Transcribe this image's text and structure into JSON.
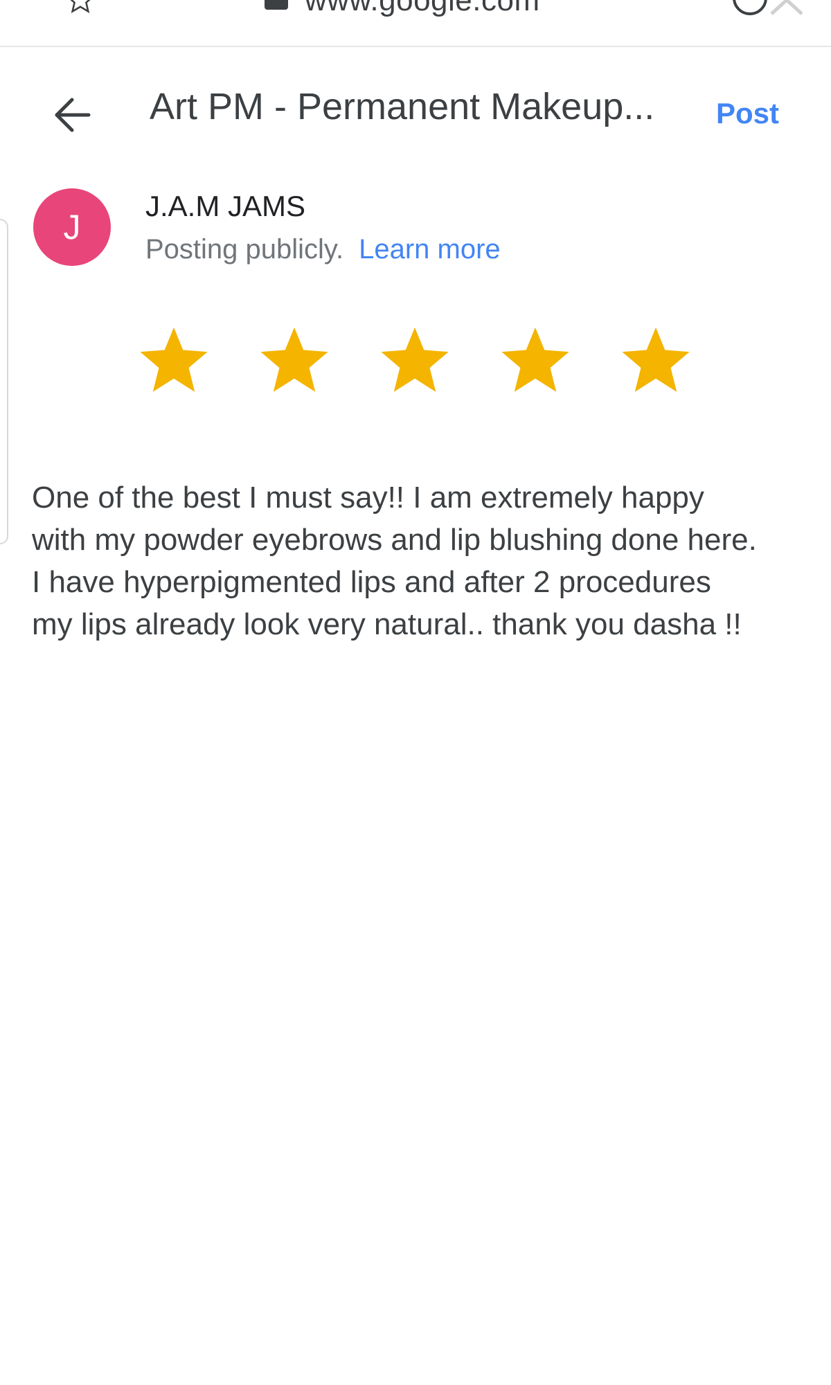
{
  "browser": {
    "url": "www.google.com"
  },
  "header": {
    "title": "Art PM - Permanent Makeup...",
    "post_label": "Post"
  },
  "user": {
    "avatar_initial": "J",
    "name": "J.A.M JAMS",
    "posting_text": "Posting publicly.",
    "learn_more": "Learn more"
  },
  "rating": {
    "stars_selected": 5,
    "stars_total": 5,
    "star_color": "#f4b400"
  },
  "review": {
    "lines": [
      "One of the best I must say!! I am extremely happy",
      "with my powder eyebrows and lip blushing done here.",
      "I have hyperpigmented lips and after 2 procedures",
      "my lips already look very natural.. thank you dasha !!"
    ]
  },
  "colors": {
    "accent": "#4285f4",
    "avatar": "#e8457a",
    "star": "#f4b400"
  }
}
